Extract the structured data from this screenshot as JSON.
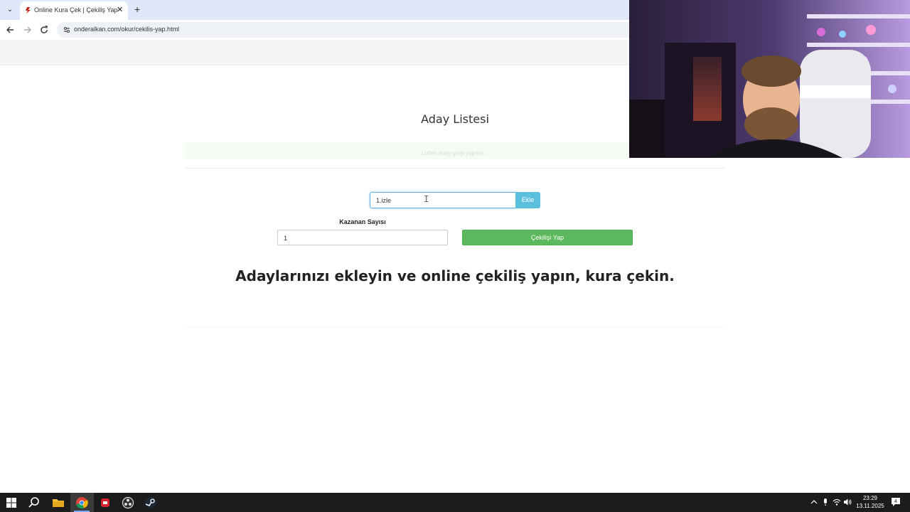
{
  "browser": {
    "tab_title": "Online Kura Çek | Çekiliş Yap",
    "url": "onderalkan.com/okur/cekilis-yap.html",
    "new_tab_label": "+",
    "tab_close_label": "✕"
  },
  "page": {
    "list_title": "Aday Listesi",
    "empty_hint": "Lütfen aday girişi yapınız...",
    "candidate_input_value": "1.izle",
    "add_button_label": "Ekle",
    "winner_count_label": "Kazanan Sayısı",
    "winner_count_value": "1",
    "draw_button_label": "Çekilişi Yap",
    "headline": "Adaylarınızı ekleyin ve online çekiliş yapın, kura çekin."
  },
  "taskbar": {
    "time": "23:29",
    "date": "13.11.2025",
    "notification_count": "4"
  },
  "colors": {
    "tab_strip": "#dfe8f8",
    "add_button": "#5bc0de",
    "draw_button": "#5cb85c",
    "input_focus": "#66afe9",
    "taskbar": "#1c1c1c"
  },
  "icons": {
    "tab_menu": "chevron-down-icon",
    "back": "back-arrow-icon",
    "forward": "forward-arrow-icon",
    "reload": "reload-icon",
    "site_info": "site-info-icon",
    "start": "windows-start-icon",
    "search": "search-icon",
    "files": "file-explorer-icon",
    "browser": "chrome-icon",
    "app1": "red-app-icon",
    "app2": "obs-icon",
    "app3": "steam-icon"
  }
}
